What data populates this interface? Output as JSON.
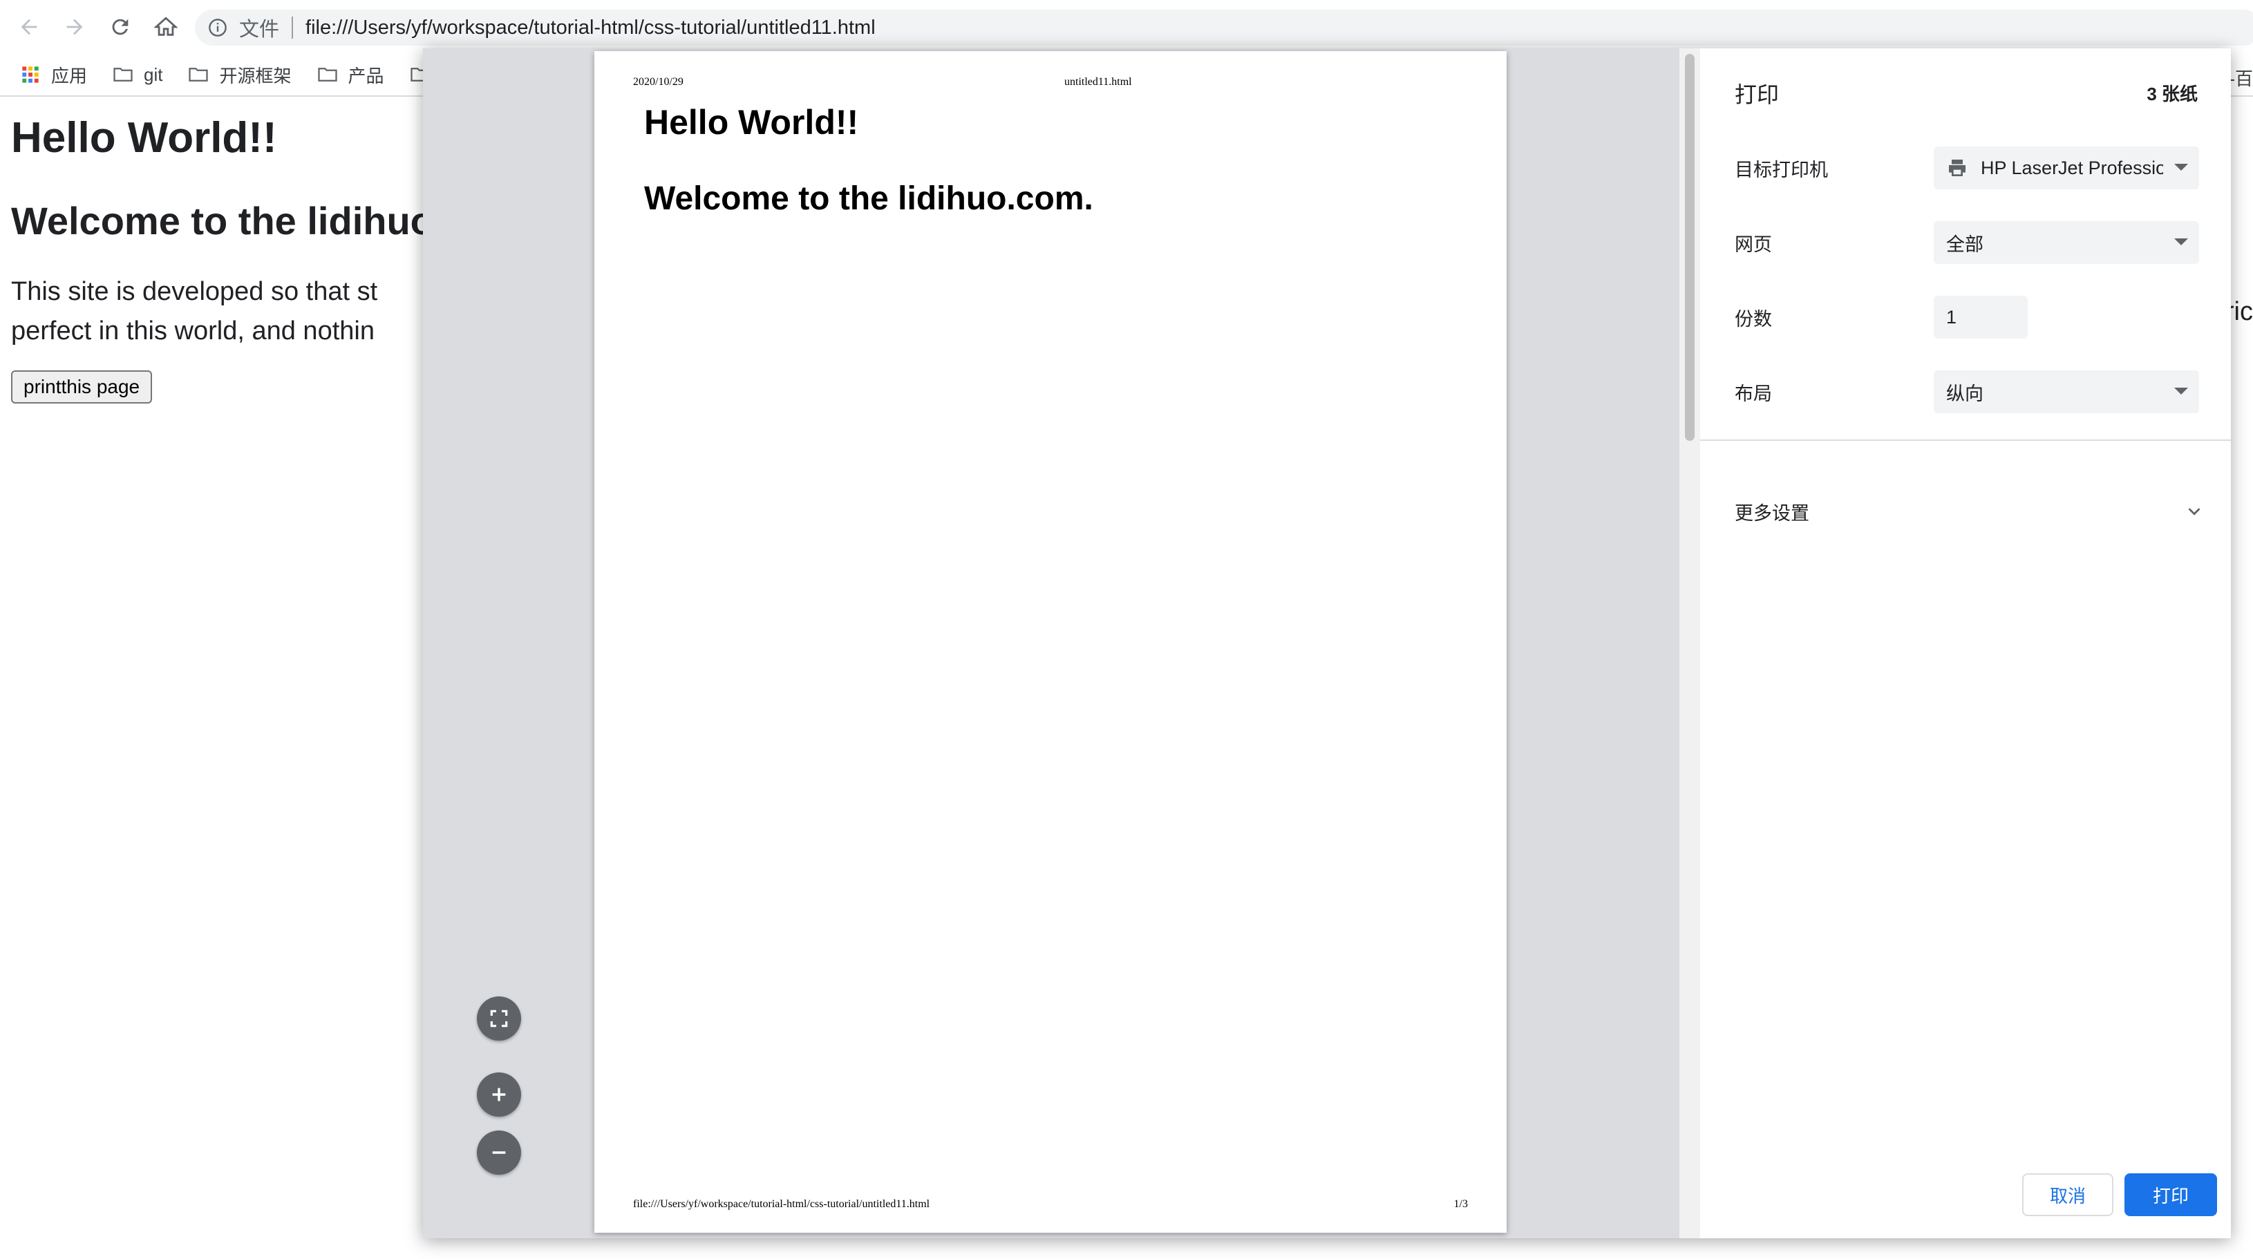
{
  "browser": {
    "scheme_label": "文件",
    "url": "file:///Users/yf/workspace/tutorial-html/css-tutorial/untitled11.html",
    "bookmarks": [
      {
        "label": "应用",
        "icon": "apps-grid-icon"
      },
      {
        "label": "git",
        "icon": "folder-icon"
      },
      {
        "label": "开源框架",
        "icon": "folder-icon"
      },
      {
        "label": "产品",
        "icon": "folder-icon"
      }
    ]
  },
  "page": {
    "heading1": "Hello World!!",
    "heading2": "Welcome to the lidihuo.com.",
    "paragraph_line1": "This site is developed so that st",
    "paragraph_line2": "perfect in this world, and nothin",
    "paragraph_right_fragment": "ric",
    "bookmark_right_fragment": "-百",
    "print_button_label": "printthis page"
  },
  "print_preview": {
    "header_date": "2020/10/29",
    "header_title": "untitled11.html",
    "doc_heading1": "Hello World!!",
    "doc_heading2": "Welcome to the lidihuo.com.",
    "footer_url": "file:///Users/yf/workspace/tutorial-html/css-tutorial/untitled11.html",
    "footer_page": "1/3",
    "zoom_controls": [
      "fit-to-page-icon",
      "zoom-in-icon",
      "zoom-out-icon"
    ]
  },
  "print_settings": {
    "title": "打印",
    "sheet_count": "3 张纸",
    "destination_label": "目标打印机",
    "destination_value": "HP LaserJet Professio",
    "pages_label": "网页",
    "pages_value": "全部",
    "copies_label": "份数",
    "copies_value": "1",
    "layout_label": "布局",
    "layout_value": "纵向",
    "more_settings_label": "更多设置",
    "cancel_label": "取消",
    "print_label": "打印",
    "accent_color": "#1a73e8"
  }
}
